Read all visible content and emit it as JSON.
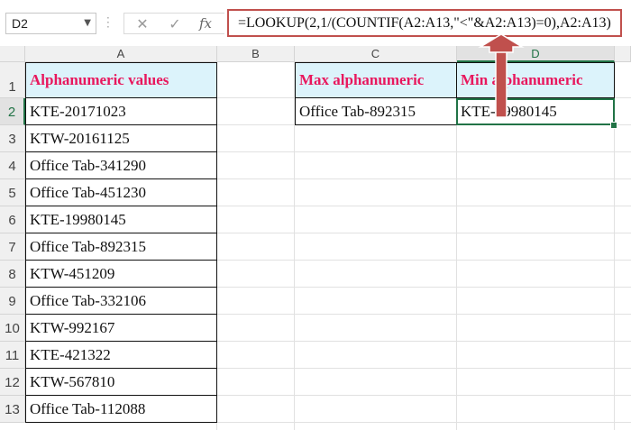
{
  "namebox": {
    "value": "D2"
  },
  "formula_bar": {
    "cancel_icon": "cancel-x-icon",
    "enter_icon": "checkmark-icon",
    "fx_label": "fx",
    "formula": "=LOOKUP(2,1/(COUNTIF(A2:A13,\"<\"&A2:A13)=0),A2:A13)"
  },
  "columns": [
    "A",
    "B",
    "C",
    "D"
  ],
  "rows": [
    "1",
    "2",
    "3",
    "4",
    "5",
    "6",
    "7",
    "8",
    "9",
    "10",
    "11",
    "12",
    "13"
  ],
  "column_a": {
    "header": "Alphanumeric values",
    "values": [
      "KTE-20171023",
      "KTW-20161125",
      "Office Tab-341290",
      "Office Tab-451230",
      "KTE-19980145",
      "Office Tab-892315",
      "KTW-451209",
      "Office Tab-332106",
      "KTW-992167",
      "KTE-421322",
      "KTW-567810",
      "Office Tab-112088"
    ]
  },
  "results": {
    "max_header": "Max alphanumeric",
    "min_header": "Min alphanumeric",
    "max_value": "Office Tab-892315",
    "min_value": "KTE-19980145"
  },
  "colors": {
    "header_fill": "#dcf3fb",
    "header_text": "#e8175d",
    "selection": "#217346",
    "callout": "#c0504d"
  }
}
